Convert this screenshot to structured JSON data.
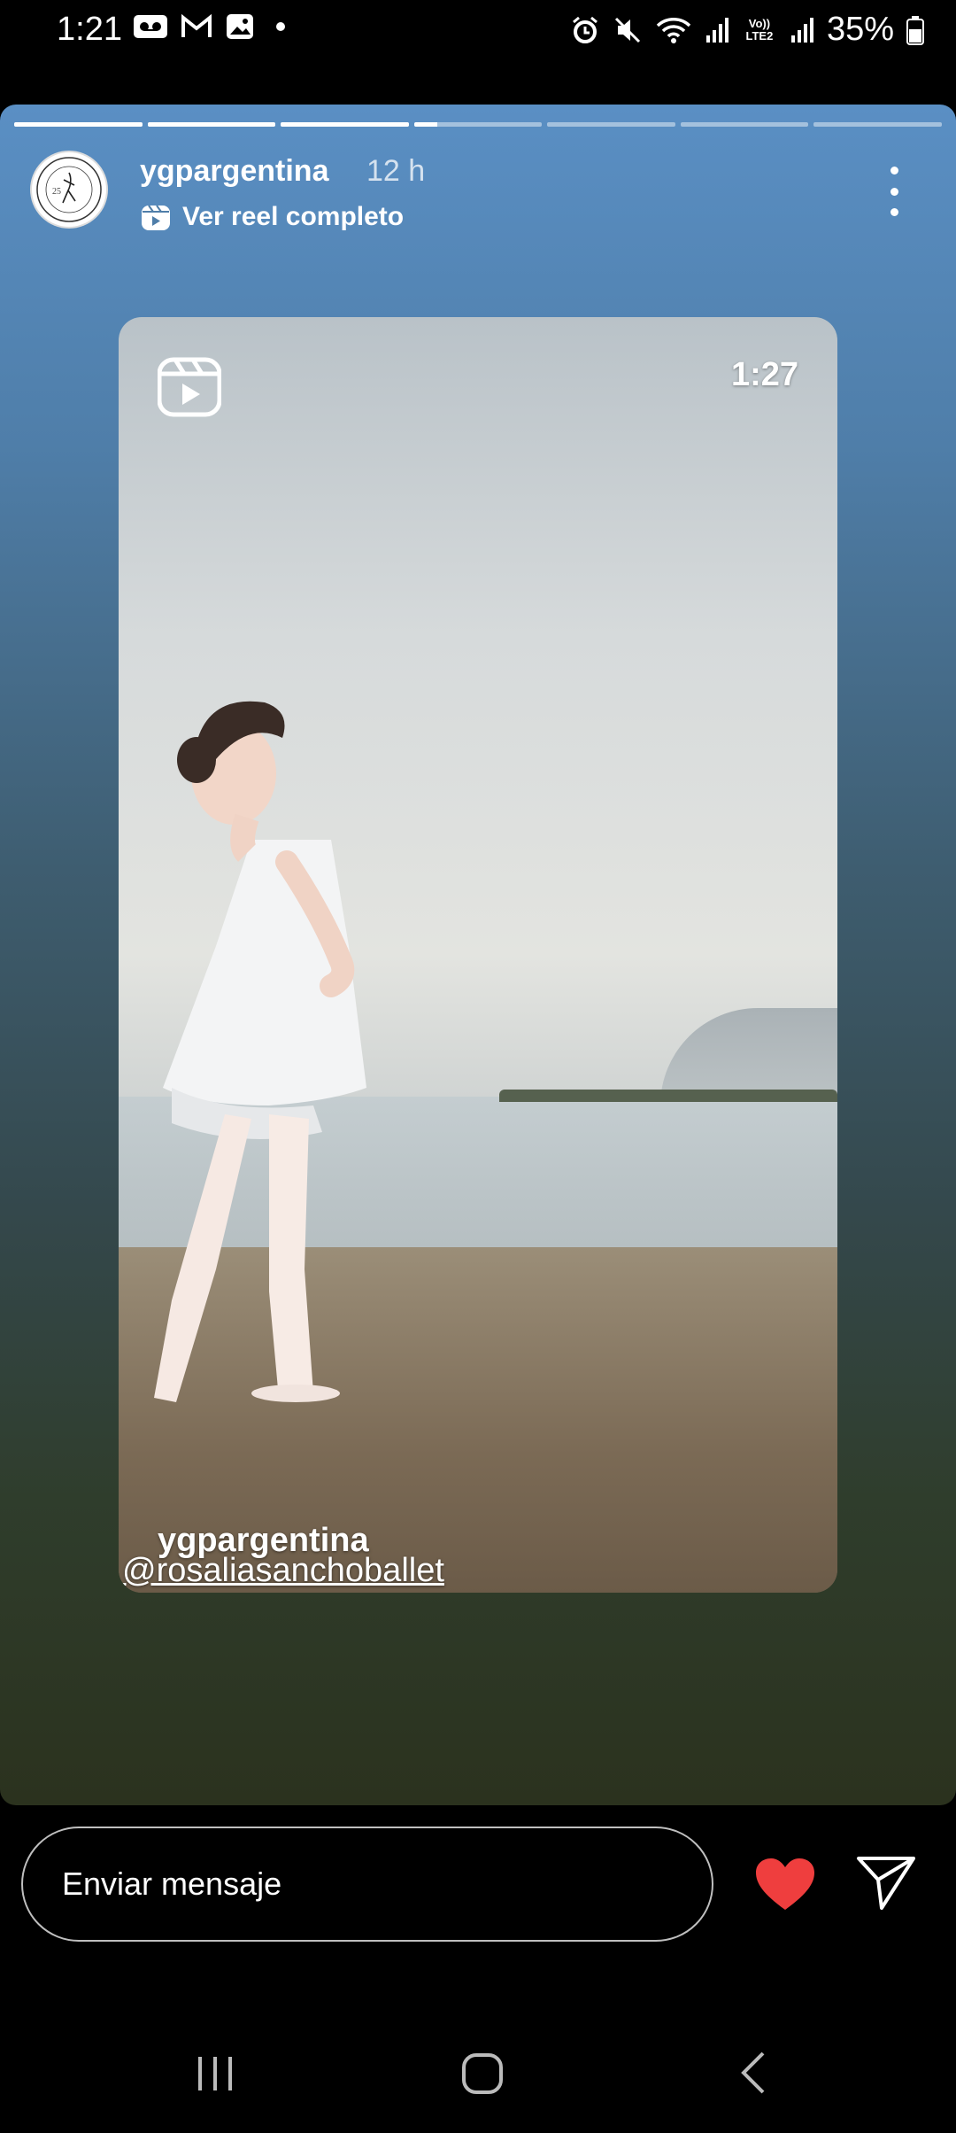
{
  "status_bar": {
    "time": "1:21",
    "battery": "35%",
    "network_label": "Vo)) LTE2"
  },
  "story": {
    "progress": {
      "segments": 7,
      "current_index": 3,
      "current_progress": 0.18
    },
    "user": "ygpargentina",
    "time_ago": "12 h",
    "reel_link": "Ver reel completo",
    "avatar_text": "SOUTH AMERICA GRAND PRIX",
    "reel": {
      "duration": "1:27",
      "caption_user": "ygpargentina",
      "caption_tag": "@rosaliasanchoballet"
    }
  },
  "footer": {
    "message_placeholder": "Enviar mensaje"
  },
  "colors": {
    "heart": "#ef3e3e"
  }
}
